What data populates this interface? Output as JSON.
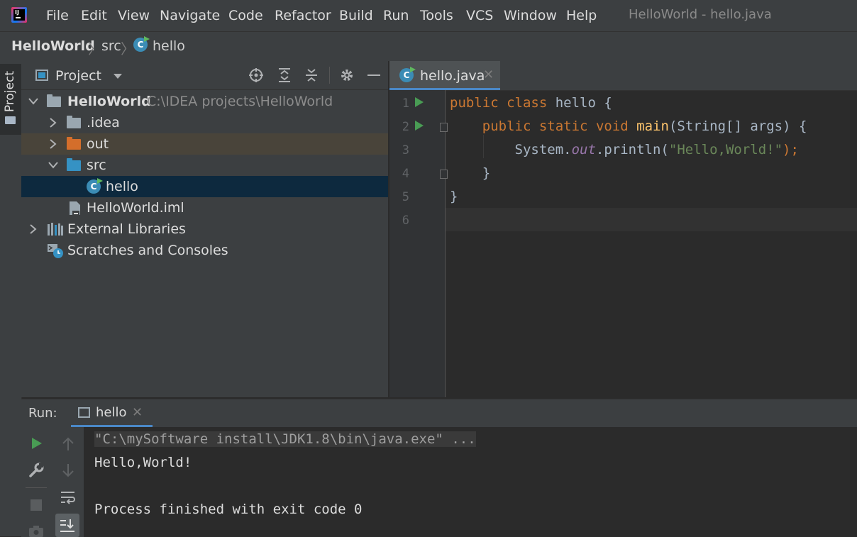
{
  "menubar": {
    "items": [
      "File",
      "Edit",
      "View",
      "Navigate",
      "Code",
      "Refactor",
      "Build",
      "Run",
      "Tools",
      "VCS",
      "Window",
      "Help"
    ],
    "window_title": "HelloWorld - hello.java",
    "logo_text": "IJ"
  },
  "breadcrumb": {
    "items": [
      "HelloWorld",
      "src",
      "hello"
    ]
  },
  "stripe": {
    "project_label": "Project"
  },
  "project_panel": {
    "title": "Project",
    "tree": [
      {
        "label": "HelloWorld",
        "path": "C:\\IDEA projects\\HelloWorld"
      },
      {
        "label": ".idea"
      },
      {
        "label": "out"
      },
      {
        "label": "src"
      },
      {
        "label": "hello"
      },
      {
        "label": "HelloWorld.iml"
      },
      {
        "label": "External Libraries"
      },
      {
        "label": "Scratches and Consoles"
      }
    ]
  },
  "editor": {
    "tab_label": "hello.java",
    "line_numbers": [
      "1",
      "2",
      "3",
      "4",
      "5",
      "6"
    ],
    "code": {
      "l1_kw1": "public",
      "l1_kw2": "class",
      "l1_name": " hello {",
      "l2_kw1": "public",
      "l2_kw2": "static",
      "l2_kw3": "void",
      "l2_fn": "main",
      "l2_rest": "(String[] args) {",
      "l3_a": "System.",
      "l3_field": "out",
      "l3_b": ".println(",
      "l3_str": "\"Hello,World!\"",
      "l3_end": ");",
      "l4": "}",
      "l5": "}"
    }
  },
  "run_panel": {
    "title": "Run:",
    "tab_label": "hello",
    "console": [
      "\"C:\\mySoftware install\\JDK1.8\\bin\\java.exe\" ...",
      "Hello,World!",
      "",
      "Process finished with exit code 0"
    ]
  },
  "colors": {
    "keyword": "#cc7832",
    "function": "#ffc66d",
    "string": "#6a8759",
    "field": "#9876aa",
    "selection": "#0d293e",
    "excluded_folder_row": "#49443a"
  }
}
